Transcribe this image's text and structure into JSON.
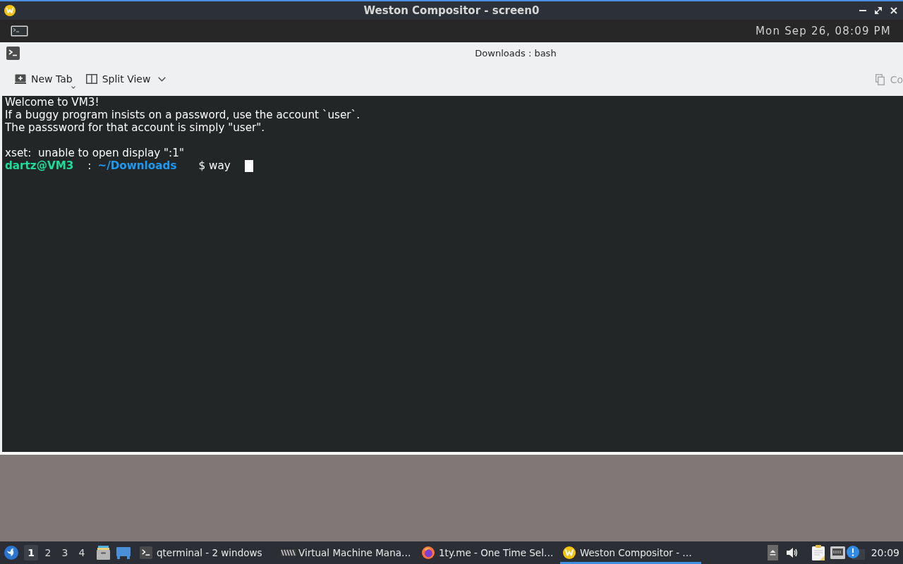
{
  "compositor": {
    "title": "Weston Compositor - screen0"
  },
  "top_panel": {
    "clock": "Mon Sep 26, 08:09 PM"
  },
  "terminal_window": {
    "title": "Downloads : bash",
    "toolbar": [
      {
        "kind": "new-tab",
        "label": "New Tab"
      },
      {
        "kind": "split-view",
        "label": "Split View"
      }
    ],
    "copy_button": {
      "label": "Co"
    },
    "motd": [
      "Welcome to VM3!",
      "If a buggy program insists on a password, use the account `user`.",
      "The passsword for that account is simply \"user\"."
    ],
    "messages": [
      "xset:  unable to open display \":1\""
    ],
    "prompt": {
      "user_host": "dartz@VM3",
      "separator": ":",
      "path": "~/Downloads",
      "symbol": "$",
      "command": "way"
    }
  },
  "taskbar": {
    "workspaces": [
      {
        "label": "1",
        "selected": true
      },
      {
        "label": "2",
        "selected": false
      },
      {
        "label": "3",
        "selected": false
      },
      {
        "label": "4",
        "selected": false
      }
    ],
    "tasks": [
      {
        "kind": "terminal",
        "label": "qterminal - 2 windows",
        "selected": false
      },
      {
        "kind": "vm",
        "label": "Virtual Machine Mana…",
        "selected": false
      },
      {
        "kind": "browser",
        "label": "1ty.me - One Time Sel…",
        "selected": false
      },
      {
        "kind": "compositor",
        "label": "Weston Compositor - …",
        "selected": true
      }
    ],
    "clock": "20:09"
  }
}
